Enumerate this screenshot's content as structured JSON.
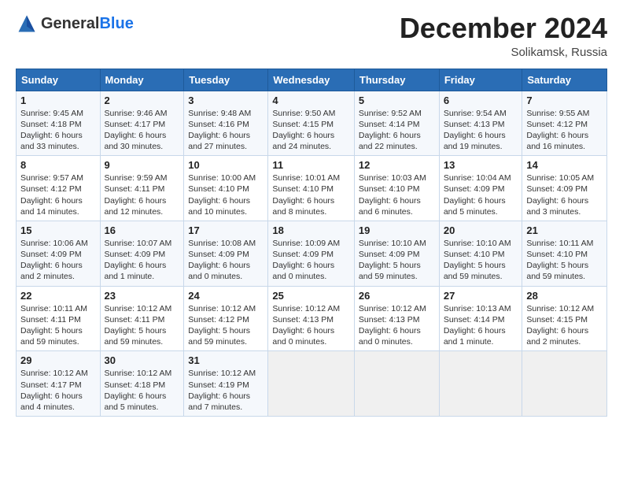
{
  "header": {
    "logo_general": "General",
    "logo_blue": "Blue",
    "month_title": "December 2024",
    "subtitle": "Solikamsk, Russia"
  },
  "days_of_week": [
    "Sunday",
    "Monday",
    "Tuesday",
    "Wednesday",
    "Thursday",
    "Friday",
    "Saturday"
  ],
  "weeks": [
    [
      {
        "day": "1",
        "info": "Sunrise: 9:45 AM\nSunset: 4:18 PM\nDaylight: 6 hours\nand 33 minutes."
      },
      {
        "day": "2",
        "info": "Sunrise: 9:46 AM\nSunset: 4:17 PM\nDaylight: 6 hours\nand 30 minutes."
      },
      {
        "day": "3",
        "info": "Sunrise: 9:48 AM\nSunset: 4:16 PM\nDaylight: 6 hours\nand 27 minutes."
      },
      {
        "day": "4",
        "info": "Sunrise: 9:50 AM\nSunset: 4:15 PM\nDaylight: 6 hours\nand 24 minutes."
      },
      {
        "day": "5",
        "info": "Sunrise: 9:52 AM\nSunset: 4:14 PM\nDaylight: 6 hours\nand 22 minutes."
      },
      {
        "day": "6",
        "info": "Sunrise: 9:54 AM\nSunset: 4:13 PM\nDaylight: 6 hours\nand 19 minutes."
      },
      {
        "day": "7",
        "info": "Sunrise: 9:55 AM\nSunset: 4:12 PM\nDaylight: 6 hours\nand 16 minutes."
      }
    ],
    [
      {
        "day": "8",
        "info": "Sunrise: 9:57 AM\nSunset: 4:12 PM\nDaylight: 6 hours\nand 14 minutes."
      },
      {
        "day": "9",
        "info": "Sunrise: 9:59 AM\nSunset: 4:11 PM\nDaylight: 6 hours\nand 12 minutes."
      },
      {
        "day": "10",
        "info": "Sunrise: 10:00 AM\nSunset: 4:10 PM\nDaylight: 6 hours\nand 10 minutes."
      },
      {
        "day": "11",
        "info": "Sunrise: 10:01 AM\nSunset: 4:10 PM\nDaylight: 6 hours\nand 8 minutes."
      },
      {
        "day": "12",
        "info": "Sunrise: 10:03 AM\nSunset: 4:10 PM\nDaylight: 6 hours\nand 6 minutes."
      },
      {
        "day": "13",
        "info": "Sunrise: 10:04 AM\nSunset: 4:09 PM\nDaylight: 6 hours\nand 5 minutes."
      },
      {
        "day": "14",
        "info": "Sunrise: 10:05 AM\nSunset: 4:09 PM\nDaylight: 6 hours\nand 3 minutes."
      }
    ],
    [
      {
        "day": "15",
        "info": "Sunrise: 10:06 AM\nSunset: 4:09 PM\nDaylight: 6 hours\nand 2 minutes."
      },
      {
        "day": "16",
        "info": "Sunrise: 10:07 AM\nSunset: 4:09 PM\nDaylight: 6 hours\nand 1 minute."
      },
      {
        "day": "17",
        "info": "Sunrise: 10:08 AM\nSunset: 4:09 PM\nDaylight: 6 hours\nand 0 minutes."
      },
      {
        "day": "18",
        "info": "Sunrise: 10:09 AM\nSunset: 4:09 PM\nDaylight: 6 hours\nand 0 minutes."
      },
      {
        "day": "19",
        "info": "Sunrise: 10:10 AM\nSunset: 4:09 PM\nDaylight: 5 hours\nand 59 minutes."
      },
      {
        "day": "20",
        "info": "Sunrise: 10:10 AM\nSunset: 4:10 PM\nDaylight: 5 hours\nand 59 minutes."
      },
      {
        "day": "21",
        "info": "Sunrise: 10:11 AM\nSunset: 4:10 PM\nDaylight: 5 hours\nand 59 minutes."
      }
    ],
    [
      {
        "day": "22",
        "info": "Sunrise: 10:11 AM\nSunset: 4:11 PM\nDaylight: 5 hours\nand 59 minutes."
      },
      {
        "day": "23",
        "info": "Sunrise: 10:12 AM\nSunset: 4:11 PM\nDaylight: 5 hours\nand 59 minutes."
      },
      {
        "day": "24",
        "info": "Sunrise: 10:12 AM\nSunset: 4:12 PM\nDaylight: 5 hours\nand 59 minutes."
      },
      {
        "day": "25",
        "info": "Sunrise: 10:12 AM\nSunset: 4:13 PM\nDaylight: 6 hours\nand 0 minutes."
      },
      {
        "day": "26",
        "info": "Sunrise: 10:12 AM\nSunset: 4:13 PM\nDaylight: 6 hours\nand 0 minutes."
      },
      {
        "day": "27",
        "info": "Sunrise: 10:13 AM\nSunset: 4:14 PM\nDaylight: 6 hours\nand 1 minute."
      },
      {
        "day": "28",
        "info": "Sunrise: 10:12 AM\nSunset: 4:15 PM\nDaylight: 6 hours\nand 2 minutes."
      }
    ],
    [
      {
        "day": "29",
        "info": "Sunrise: 10:12 AM\nSunset: 4:17 PM\nDaylight: 6 hours\nand 4 minutes."
      },
      {
        "day": "30",
        "info": "Sunrise: 10:12 AM\nSunset: 4:18 PM\nDaylight: 6 hours\nand 5 minutes."
      },
      {
        "day": "31",
        "info": "Sunrise: 10:12 AM\nSunset: 4:19 PM\nDaylight: 6 hours\nand 7 minutes."
      },
      null,
      null,
      null,
      null
    ]
  ]
}
